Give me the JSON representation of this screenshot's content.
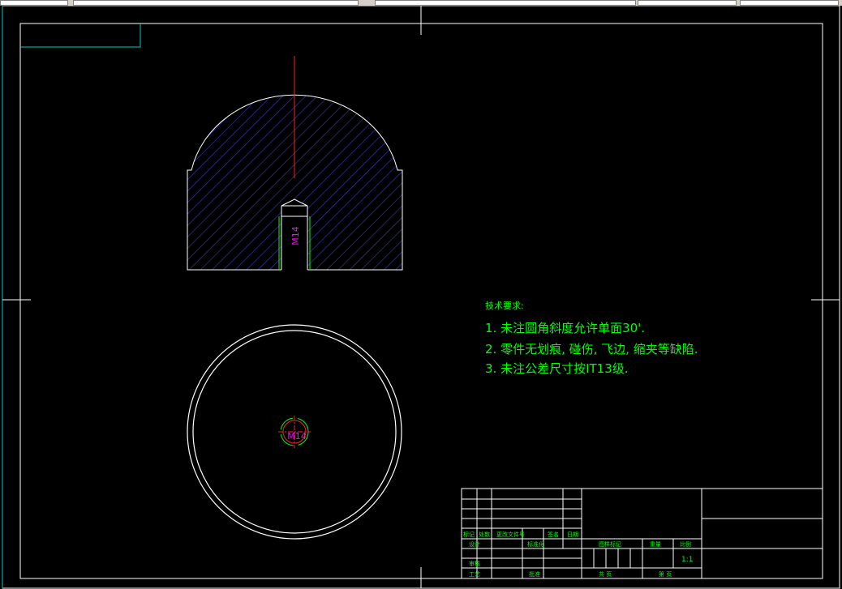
{
  "drawing": {
    "thread_label_front": "M14",
    "thread_label_top": "M14",
    "tech_title": "技术要求:",
    "tech_notes": [
      "1. 未注圆角斜度允许单面30'.",
      "2. 零件无划痕, 碰伤, 飞边, 缩夹等缺陷.",
      "3. 未注公差尺寸按IT13级."
    ]
  },
  "title_block": {
    "row_labels": [
      "标记",
      "处数",
      "更改文件号",
      "签名",
      "日期"
    ],
    "design_label": "设计",
    "standard_label": "标准化",
    "check_label": "审核",
    "process_label": "工艺",
    "approve_label": "批准",
    "stage_mark_label": "图样标记",
    "weight_label": "重量",
    "scale_label": "比例",
    "scale_value": "1:1",
    "sheet_total_label": "共 页",
    "sheet_no_label": "第 页"
  },
  "colors": {
    "background": "#000000",
    "lines": "#ffffff",
    "hatch": "#3c3cc8",
    "centerline": "#ff2020",
    "thread": "#00ff00",
    "dimension": "#ff00ff",
    "text": "#00ff00",
    "border_accent": "#00c8c8"
  }
}
